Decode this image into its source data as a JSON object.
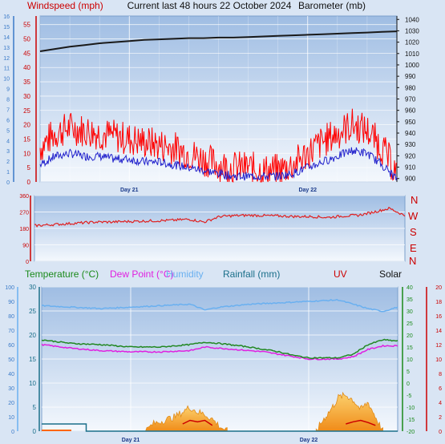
{
  "header": {
    "left_label": "Windspeed (mph)",
    "title": "Current last 48 hours 22 October 2024",
    "right_label": "Barometer (mb)"
  },
  "middle_panel": {
    "compass_labels": [
      "N",
      "W",
      "S",
      "E",
      "N"
    ]
  },
  "bottom_header": {
    "temperature": "Temperature (°C)",
    "dew_point": "Dew Point (°C)",
    "humidity": "Humidity",
    "rainfall": "Rainfall (mm)",
    "uv": "UV",
    "solar": "Solar"
  },
  "colors": {
    "page_bg": "#d9e5f4",
    "plot_bg_top": "#9fbde3",
    "plot_bg_bottom": "#f4f8fd",
    "grid": "#ffffff",
    "barometer": "#1a1a1a",
    "wind_gust": "#ff0000",
    "wind_avg": "#2222cc",
    "wind_dir": "#e02020",
    "temperature": "#228822",
    "dew_point": "#e020e0",
    "humidity": "#6ab0f0",
    "rainfall": "#1a6f8a",
    "uv": "#cc0000",
    "solar_fill": "#ffb020",
    "solar_line": "#e08000",
    "axis_red": "#cc0000",
    "axis_blue": "#3a7ac8",
    "axis_green": "#1a8a1a",
    "axis_black": "#111111"
  },
  "chart_data": [
    {
      "type": "line",
      "name": "wind-barometer",
      "x_range_hours": [
        0,
        48
      ],
      "day_markers": [
        {
          "label": "Day 21",
          "hour": 12
        },
        {
          "label": "Day 22",
          "hour": 36
        }
      ],
      "y_left": {
        "label": "Windspeed (mph)",
        "range": [
          0,
          58
        ],
        "ticks": [
          0,
          5,
          10,
          15,
          20,
          25,
          30,
          35,
          40,
          45,
          50,
          55
        ]
      },
      "y_left_inner": {
        "range": [
          0,
          16
        ],
        "ticks": [
          0,
          1,
          2,
          3,
          4,
          5,
          6,
          7,
          8,
          9,
          10,
          11,
          12,
          13,
          14,
          15,
          16
        ]
      },
      "y_right": {
        "label": "Barometer (mb)",
        "range": [
          897,
          1043
        ],
        "ticks": [
          900,
          910,
          920,
          930,
          940,
          950,
          960,
          970,
          980,
          990,
          1000,
          1010,
          1020,
          1030,
          1040
        ]
      },
      "series": [
        {
          "name": "Barometer",
          "axis": "right",
          "x": [
            0,
            2,
            4,
            6,
            8,
            10,
            12,
            14,
            16,
            18,
            20,
            22,
            24,
            26,
            28,
            30,
            32,
            34,
            36,
            38,
            40,
            42,
            44,
            46,
            48
          ],
          "values": [
            1012,
            1014,
            1016,
            1017.5,
            1019,
            1020,
            1021,
            1022,
            1022.5,
            1023,
            1023.5,
            1023.5,
            1024,
            1024,
            1024.5,
            1025,
            1025.5,
            1026,
            1026.5,
            1027,
            1027.5,
            1028,
            1028.5,
            1029,
            1029.5
          ]
        },
        {
          "name": "Wind gust",
          "axis": "left",
          "x": [
            0,
            2,
            4,
            6,
            8,
            10,
            12,
            14,
            16,
            18,
            20,
            22,
            24,
            26,
            28,
            30,
            32,
            34,
            36,
            38,
            40,
            42,
            44,
            46,
            48
          ],
          "values": [
            12,
            17,
            19,
            18,
            17,
            16,
            15,
            14,
            13,
            12,
            10,
            8,
            6,
            5,
            5,
            4,
            4,
            6,
            10,
            14,
            17,
            20,
            18,
            12,
            3
          ]
        },
        {
          "name": "Wind average",
          "axis": "left",
          "x": [
            0,
            2,
            4,
            6,
            8,
            10,
            12,
            14,
            16,
            18,
            20,
            22,
            24,
            26,
            28,
            30,
            32,
            34,
            36,
            38,
            40,
            42,
            44,
            46,
            48
          ],
          "values": [
            6,
            9,
            10,
            9,
            9,
            8,
            8,
            7,
            7,
            6,
            5,
            4,
            3,
            2,
            2,
            2,
            2,
            3,
            5,
            7,
            9,
            11,
            10,
            6,
            1
          ]
        }
      ]
    },
    {
      "type": "line",
      "name": "wind-direction",
      "x_range_hours": [
        0,
        48
      ],
      "y_left": {
        "range": [
          0,
          360
        ],
        "ticks": [
          0,
          90,
          180,
          270,
          360
        ]
      },
      "series": [
        {
          "name": "Wind direction",
          "x": [
            0,
            2,
            4,
            6,
            8,
            10,
            12,
            14,
            16,
            18,
            20,
            22,
            24,
            26,
            28,
            30,
            32,
            34,
            36,
            38,
            40,
            42,
            44,
            46,
            48
          ],
          "values": [
            195,
            200,
            205,
            210,
            215,
            215,
            218,
            220,
            222,
            225,
            230,
            215,
            245,
            250,
            252,
            250,
            248,
            245,
            245,
            240,
            248,
            252,
            270,
            290,
            250
          ]
        }
      ]
    },
    {
      "type": "line",
      "name": "temperature-humidity-rain-solar",
      "x_range_hours": [
        0,
        48
      ],
      "day_markers": [
        {
          "label": "Day 21",
          "hour": 12
        },
        {
          "label": "Day 22",
          "hour": 36
        }
      ],
      "y_left_outer": {
        "label": "Humidity",
        "range": [
          0,
          100
        ],
        "ticks": [
          0,
          10,
          20,
          30,
          40,
          50,
          60,
          70,
          80,
          90,
          100
        ]
      },
      "y_left_inner": {
        "label": "Rainfall (mm)",
        "range": [
          0,
          30
        ],
        "ticks": [
          0,
          5,
          10,
          15,
          20,
          25,
          30
        ]
      },
      "y_right_temp": {
        "label": "Temperature (°C)",
        "range": [
          -20,
          40
        ],
        "ticks": [
          -20,
          -15,
          -10,
          -5,
          0,
          5,
          10,
          15,
          20,
          25,
          30,
          35,
          40
        ]
      },
      "y_right_uv": {
        "label": "UV",
        "range": [
          0,
          20
        ],
        "ticks": [
          0,
          2,
          4,
          6,
          8,
          10,
          12,
          14,
          16,
          18,
          20
        ]
      },
      "series": [
        {
          "name": "Humidity",
          "axis": "left_outer",
          "x": [
            0,
            4,
            8,
            12,
            16,
            20,
            22,
            24,
            28,
            32,
            36,
            40,
            42,
            44,
            46,
            48
          ],
          "values": [
            87,
            86,
            85,
            86,
            87,
            88,
            84,
            86,
            88,
            89,
            90,
            91,
            88,
            85,
            83,
            86
          ]
        },
        {
          "name": "Temperature",
          "axis": "right_temp",
          "x": [
            0,
            4,
            8,
            12,
            16,
            20,
            22,
            24,
            28,
            30,
            32,
            34,
            36,
            38,
            40,
            42,
            44,
            46,
            48
          ],
          "values": [
            18,
            16.5,
            16,
            15,
            15,
            16,
            17,
            16.5,
            15,
            14,
            13,
            11.5,
            10.5,
            10.5,
            10.5,
            12,
            16,
            18,
            17.5
          ]
        },
        {
          "name": "Dew Point",
          "axis": "right_temp",
          "x": [
            0,
            4,
            8,
            12,
            16,
            20,
            22,
            24,
            28,
            30,
            32,
            34,
            36,
            38,
            40,
            42,
            44,
            46,
            48
          ],
          "values": [
            16,
            14.5,
            13.5,
            13,
            13,
            13.5,
            15,
            14.5,
            13.5,
            13,
            12,
            11,
            10,
            10,
            10,
            11,
            14,
            15.5,
            15.5
          ]
        },
        {
          "name": "Rainfall",
          "axis": "left_inner",
          "x": [
            0,
            6,
            6,
            48
          ],
          "values": [
            1.5,
            1.5,
            0,
            0
          ]
        },
        {
          "name": "Solar",
          "axis": "right_temp",
          "x": [
            14,
            15,
            16,
            17,
            18,
            19,
            20,
            21,
            22,
            23,
            24,
            25,
            37,
            38,
            39,
            40,
            41,
            42,
            43,
            44,
            45,
            46
          ],
          "values": [
            -20,
            -17,
            -16,
            -15,
            -14,
            -12,
            -10,
            -12,
            -13,
            -15,
            -18,
            -20,
            -20,
            -15,
            -11,
            -6,
            -5,
            -7,
            -11,
            -8,
            -14,
            -20
          ]
        },
        {
          "name": "UV",
          "axis": "right_uv",
          "x": [
            19,
            20,
            21,
            22,
            23,
            41,
            42,
            43,
            44,
            45
          ],
          "values": [
            1,
            1.5,
            1.3,
            1.5,
            0.8,
            1,
            1.3,
            1.5,
            1.2,
            0.8
          ]
        }
      ]
    }
  ]
}
